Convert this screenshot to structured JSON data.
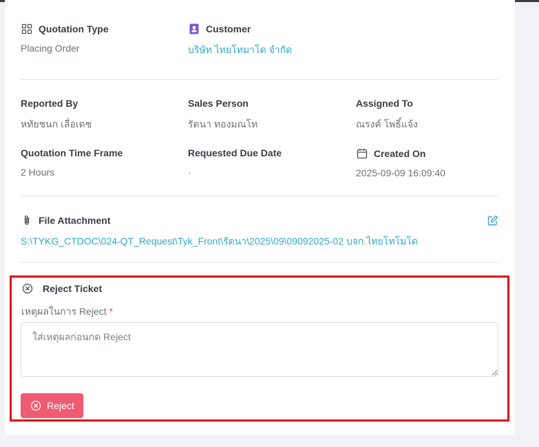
{
  "header": {
    "quotation_type": {
      "label": "Quotation Type",
      "value": "Placing Order",
      "icon": "grid-icon"
    },
    "customer": {
      "label": "Customer",
      "value": "บริษัท ไทยโทมาโด จำกัด",
      "icon": "contact-card-icon"
    }
  },
  "details": {
    "reported_by": {
      "label": "Reported By",
      "value": "หทัยชนก เลื่อเดช"
    },
    "sales_person": {
      "label": "Sales Person",
      "value": "รัตนา ทองมณโท"
    },
    "assigned_to": {
      "label": "Assigned To",
      "value": "ณรงค์ โพธิ์แจ้ง"
    },
    "time_frame": {
      "label": "Quotation Time Frame",
      "value": "2 Hours"
    },
    "due_date": {
      "label": "Requested Due Date",
      "value": "-"
    },
    "created_on": {
      "label": "Created On",
      "value": "2025-09-09 16:09:40",
      "icon": "calendar-icon"
    }
  },
  "attachment": {
    "label": "File Attachment",
    "path": "S:\\TYKG_CTDOC\\024-QT_Request\\Tyk_Front\\รัตนา\\2025\\09\\09092025-02 บจก.ไทยโทโมโด",
    "icon": "paperclip-icon",
    "edit_icon": "edit-icon"
  },
  "reject": {
    "title": "Reject Ticket",
    "reason_label": "เหตุผลในการ Reject",
    "required_mark": "*",
    "reason_placeholder": "ใส่เหตุผลก่อนกด Reject",
    "reason_value": "",
    "button_label": "Reject",
    "icon": "circle-x-icon"
  },
  "colors": {
    "link": "#2fa8c9",
    "reject_button": "#ef5b72",
    "highlight_border": "#dd0f13",
    "required": "#e04f5f"
  }
}
